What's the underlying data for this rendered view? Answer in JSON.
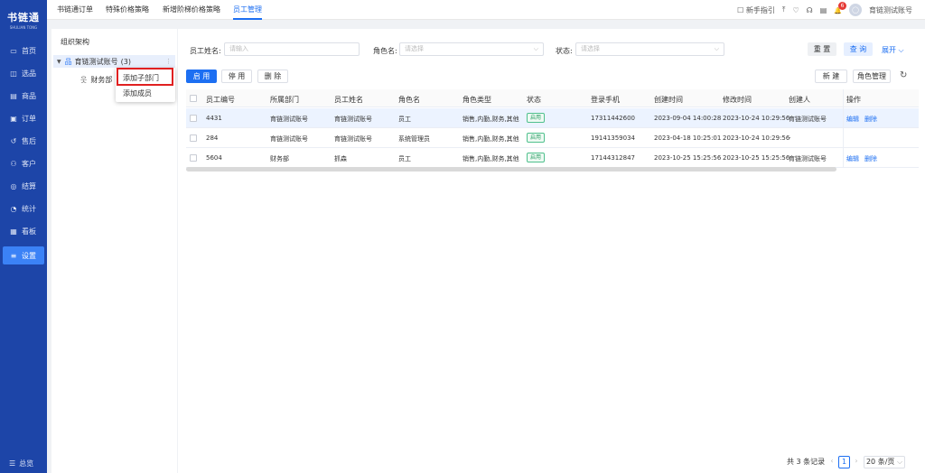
{
  "brand": {
    "name": "书链通",
    "tagline": "SHULIAN TONG"
  },
  "sidebar": {
    "items": [
      {
        "icon": "home-icon",
        "glyph": "▭",
        "label": "首页"
      },
      {
        "icon": "select-icon",
        "glyph": "◫",
        "label": "选品"
      },
      {
        "icon": "goods-icon",
        "glyph": "▤",
        "label": "商品"
      },
      {
        "icon": "order-icon",
        "glyph": "▣",
        "label": "订单"
      },
      {
        "icon": "aftersale-icon",
        "glyph": "↺",
        "label": "售后"
      },
      {
        "icon": "customer-icon",
        "glyph": "⚇",
        "label": "客户"
      },
      {
        "icon": "settle-icon",
        "glyph": "◎",
        "label": "结算"
      },
      {
        "icon": "stats-icon",
        "glyph": "◔",
        "label": "统计"
      },
      {
        "icon": "board-icon",
        "glyph": "▦",
        "label": "看板"
      },
      {
        "icon": "settings-icon",
        "glyph": "≡",
        "label": "设置"
      }
    ],
    "bottom_label": "总览",
    "bottom_glyph": "☰"
  },
  "topbar": {
    "tabs": [
      "书链通订单",
      "特殊价格策略",
      "新增阶梯价格策略",
      "员工管理"
    ],
    "guide": "新手指引",
    "guide_glyph": "☐",
    "notif_count": "6",
    "user": "育链测试账号",
    "icons": {
      "upload": "⤒",
      "heart": "♡",
      "headset": "☊",
      "doc": "▤",
      "bell": "🔔",
      "avatar": "◯"
    }
  },
  "tree": {
    "title": "组织架构",
    "root": "育链测试账号",
    "root_count": "(3)",
    "child": "财务部",
    "caret": "▼",
    "org_glyph": "品",
    "more": "⋮",
    "person": "웃"
  },
  "context_menu": {
    "add_sub_dept": "添加子部门",
    "add_member": "添加成员"
  },
  "filters": {
    "name_label": "员工姓名:",
    "name_placeholder": "请输入",
    "role_label": "角色名:",
    "role_placeholder": "请选择",
    "status_label": "状态:",
    "status_placeholder": "请选择",
    "chevron": "⌵"
  },
  "actions": {
    "reset": "重 置",
    "search": "查 询",
    "expand": "展开",
    "expand_chevron": "⌵",
    "enable": "启 用",
    "disable": "停 用",
    "delete": "删 除",
    "create": "新 建",
    "role_manage": "角色管理",
    "refresh": "↻"
  },
  "table": {
    "columns": [
      "员工编号",
      "所属部门",
      "员工姓名",
      "角色名",
      "角色类型",
      "状态",
      "登录手机",
      "创建时间",
      "修改时间",
      "创建人",
      "操作"
    ],
    "rows": [
      {
        "id": "4431",
        "dept": "育链测试账号",
        "name": "育链测试账号",
        "role": "员工",
        "role_type": "销售,内勤,财务,其他",
        "status": "启用",
        "phone": "17311442600",
        "created": "2023-09-04 14:00:28",
        "modified": "2023-10-24 10:29:56",
        "creator": "育链测试账号",
        "edit": "编辑",
        "del": "删除"
      },
      {
        "id": "284",
        "dept": "育链测试账号",
        "name": "育链测试账号",
        "role": "系统管理员",
        "role_type": "销售,内勤,财务,其他",
        "status": "启用",
        "phone": "19141359034",
        "created": "2023-04-18 10:25:01",
        "modified": "2023-10-24 10:29:56",
        "creator": "-",
        "edit": "",
        "del": ""
      },
      {
        "id": "5604",
        "dept": "财务部",
        "name": "抓森",
        "role": "员工",
        "role_type": "销售,内勤,财务,其他",
        "status": "启用",
        "phone": "17144312847",
        "created": "2023-10-25 15:25:56",
        "modified": "2023-10-25 15:25:56",
        "creator": "育链测试账号",
        "edit": "编辑",
        "del": "删除"
      }
    ]
  },
  "pagination": {
    "total": "共 3 条记录",
    "prev": "‹",
    "page": "1",
    "next": "›",
    "page_size": "20 条/页",
    "page_size_chevron": "⌵"
  }
}
